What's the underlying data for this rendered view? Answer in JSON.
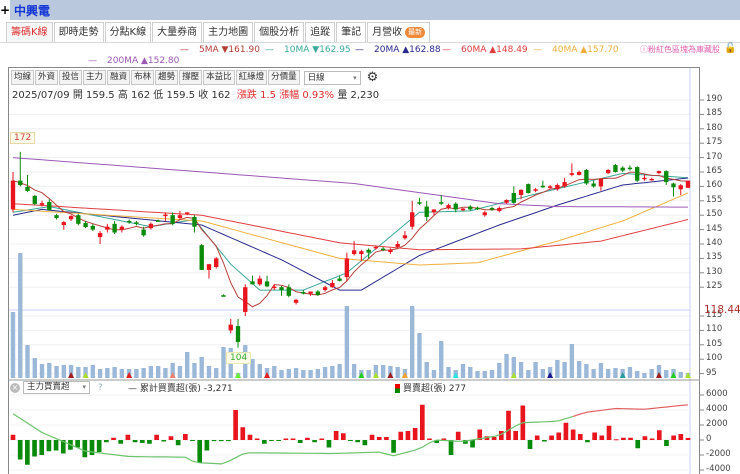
{
  "header": {
    "plus": "+",
    "stock_name": "中興電"
  },
  "tabs": [
    {
      "label": "籌碼K線",
      "active": true
    },
    {
      "label": "即時走勢"
    },
    {
      "label": "分點K線"
    },
    {
      "label": "大量券商"
    },
    {
      "label": "主力地圖"
    },
    {
      "label": "個股分析"
    },
    {
      "label": "追蹤"
    },
    {
      "label": "筆記"
    },
    {
      "label": "月營收",
      "badge": "最新"
    }
  ],
  "ma_legend": [
    {
      "label": "5MA ▼161.90",
      "color": "#b5403a"
    },
    {
      "label": "10MA ▼162.95",
      "color": "#3aa89a"
    },
    {
      "label": "20MA ▲162.88",
      "color": "#2b2b8c"
    },
    {
      "label": "60MA ▲148.49",
      "color": "#e04040"
    },
    {
      "label": "40MA ▲157.70",
      "color": "#f0b040"
    },
    {
      "label": "200MA ▲152.80",
      "color": "#9b59b6"
    }
  ],
  "note": "ⓘ粉紅色區塊為庫藏股",
  "toolbar": {
    "buttons": [
      "均線",
      "外資",
      "投信",
      "主力",
      "融資",
      "布林",
      "趨勢",
      "撐壓",
      "本益比",
      "紅綠燈",
      "分價量"
    ],
    "period": "日線"
  },
  "info": {
    "date": "2025/07/09",
    "open": "開 159.5",
    "high": "高 162",
    "low": "低 159.5",
    "close": "收 162",
    "change": "漲跌 1.5",
    "pct": "漲幅 0.93%",
    "volume": "量 2,230"
  },
  "indicator": {
    "select": "主力買賣超",
    "help": "?",
    "cum_label": "累計買賣超(張) -3,271",
    "net_label": "買賣超(張) 277"
  },
  "chart_data": [
    {
      "type": "candlestick",
      "title": "中興電 日線",
      "ylim": [
        95,
        190
      ],
      "yticks": [
        190,
        185,
        180,
        175,
        170,
        165,
        160,
        155,
        150,
        145,
        140,
        135,
        130,
        125,
        115,
        110,
        105,
        100,
        95
      ],
      "last_label": "118.44",
      "high_label": "172",
      "low_label": "104",
      "ohlc": [
        [
          152,
          165,
          151,
          162
        ],
        [
          162,
          172,
          160,
          160.5
        ],
        [
          159.8,
          164,
          158,
          158.4
        ],
        [
          156.7,
          157,
          153.5,
          153.9
        ],
        [
          153.6,
          155,
          153,
          154.2
        ],
        [
          154.6,
          155.5,
          151.5,
          151.8
        ],
        [
          150,
          150.5,
          148.5,
          149
        ],
        [
          146.6,
          148,
          145,
          147.6
        ],
        [
          148.6,
          150,
          148,
          149.7
        ],
        [
          150,
          150.5,
          146.5,
          147
        ],
        [
          147.3,
          148,
          145.5,
          145.9
        ],
        [
          146.3,
          147,
          144.5,
          145
        ],
        [
          142.4,
          144.5,
          140,
          143.8
        ],
        [
          145,
          147,
          144,
          146
        ],
        [
          147,
          148,
          143.5,
          144
        ],
        [
          145,
          146.5,
          144,
          146
        ],
        [
          148,
          148.5,
          147,
          147.5
        ],
        [
          147.5,
          148,
          146.5,
          147
        ],
        [
          145,
          146,
          142.5,
          143
        ],
        [
          145.5,
          147.5,
          145,
          147
        ],
        [
          148.2,
          148.5,
          147.8,
          148
        ],
        [
          149.8,
          151,
          148,
          150.2
        ],
        [
          150,
          151,
          146.5,
          147
        ],
        [
          149,
          151.5,
          148.5,
          150
        ],
        [
          150.6,
          151,
          150,
          151
        ],
        [
          149.4,
          150,
          144,
          146
        ],
        [
          139.6,
          140,
          131,
          131
        ],
        [
          131,
          133,
          128,
          133
        ],
        [
          132,
          135.5,
          131.5,
          135
        ],
        [
          122.2,
          122.5,
          121.8,
          122
        ],
        [
          110,
          114,
          109,
          112
        ],
        [
          111.5,
          114,
          104,
          106
        ],
        [
          116.4,
          126,
          115,
          125
        ],
        [
          127,
          129,
          126,
          126
        ],
        [
          126,
          129,
          125.5,
          128
        ],
        [
          127,
          129,
          125,
          125.3
        ],
        [
          124.8,
          126,
          124,
          125.2
        ],
        [
          125,
          125.5,
          122,
          124
        ],
        [
          125,
          126,
          121.5,
          122
        ],
        [
          119.6,
          121,
          119,
          120.6
        ],
        [
          123.3,
          124,
          122.5,
          123
        ],
        [
          122.8,
          123.5,
          122,
          123.5
        ],
        [
          123.5,
          124,
          122,
          122.3
        ],
        [
          124,
          125.5,
          123.5,
          125
        ],
        [
          125,
          127.5,
          124.8,
          126.5
        ],
        [
          128,
          129,
          127,
          127.2
        ],
        [
          128.5,
          137,
          127,
          135
        ],
        [
          136.5,
          141,
          136,
          137.8
        ],
        [
          136.5,
          138,
          134,
          137.5
        ],
        [
          138,
          138.5,
          135,
          137
        ],
        [
          138.5,
          139.5,
          138,
          139
        ],
        [
          138.4,
          139,
          137.5,
          138
        ],
        [
          137.2,
          138.5,
          136.5,
          138
        ],
        [
          139,
          141,
          138.5,
          140
        ],
        [
          142,
          144.5,
          141.5,
          143
        ],
        [
          146,
          155,
          145,
          151
        ],
        [
          154.5,
          156,
          153.5,
          154
        ],
        [
          153,
          155,
          148,
          149.4
        ],
        [
          151,
          152,
          150,
          152
        ],
        [
          154.5,
          157,
          153.5,
          154
        ],
        [
          152.5,
          154,
          152,
          153.5
        ],
        [
          154,
          154.5,
          151,
          152
        ],
        [
          151.7,
          152.5,
          151.5,
          152.3
        ],
        [
          153,
          153.5,
          151.5,
          152
        ],
        [
          152.6,
          153,
          151.8,
          152.2
        ],
        [
          150,
          151.5,
          149.5,
          151
        ],
        [
          152.5,
          153,
          151.5,
          152
        ],
        [
          151.5,
          153,
          151,
          152.5
        ],
        [
          154.3,
          155.5,
          154,
          155.3
        ],
        [
          157.7,
          160,
          154,
          154.3
        ],
        [
          157,
          159,
          155.5,
          158.8
        ],
        [
          160.8,
          161,
          157.5,
          157.7
        ],
        [
          158.5,
          159.5,
          158,
          159
        ],
        [
          160.2,
          162,
          159.5,
          159.8
        ],
        [
          159.5,
          160.5,
          159,
          160
        ],
        [
          159,
          161,
          158.5,
          160.5
        ],
        [
          160,
          163,
          159.5,
          161.5
        ],
        [
          164,
          168,
          163.5,
          164.6
        ],
        [
          164,
          165.5,
          163.8,
          165
        ],
        [
          165.7,
          166,
          160.5,
          161
        ],
        [
          161,
          162,
          159.5,
          160
        ],
        [
          160,
          162.8,
          158.5,
          162.6
        ],
        [
          164.6,
          166,
          164.3,
          165.7
        ],
        [
          167.4,
          167.8,
          164.8,
          165
        ],
        [
          166.5,
          167,
          165,
          165.5
        ],
        [
          166.5,
          167.3,
          165.5,
          166
        ],
        [
          166.7,
          167,
          161.5,
          162
        ],
        [
          162.5,
          164,
          162,
          163
        ],
        [
          162.4,
          163,
          162,
          162.6
        ],
        [
          164.6,
          165.5,
          164.2,
          165.3
        ],
        [
          165.3,
          165.6,
          160.5,
          161.5
        ],
        [
          161,
          161.3,
          156.5,
          159.7
        ],
        [
          159,
          160.8,
          157,
          160.4
        ],
        [
          159.5,
          162,
          159.5,
          162
        ]
      ],
      "ma_knots": {
        "10MA": [
          [
            0,
            151
          ],
          [
            5,
            153
          ],
          [
            19,
            146
          ],
          [
            25,
            148.5
          ],
          [
            30,
            133
          ],
          [
            34,
            124
          ],
          [
            40,
            124
          ],
          [
            46,
            130
          ],
          [
            56,
            151
          ],
          [
            63,
            151.5
          ],
          [
            73,
            158
          ],
          [
            84,
            164.5
          ],
          [
            93,
            163
          ]
        ],
        "20MA": [
          [
            0,
            150
          ],
          [
            4,
            152
          ],
          [
            26,
            146.6
          ],
          [
            37,
            134.5
          ],
          [
            45,
            124
          ],
          [
            48,
            124
          ],
          [
            56,
            136
          ],
          [
            67,
            146.6
          ],
          [
            75,
            153.5
          ],
          [
            84,
            160.5
          ],
          [
            93,
            162.9
          ]
        ],
        "40MA": [
          [
            0,
            152
          ],
          [
            26,
            148
          ],
          [
            45,
            135
          ],
          [
            56,
            132.7
          ],
          [
            64,
            133.5
          ],
          [
            75,
            141
          ],
          [
            84,
            148
          ],
          [
            93,
            157.7
          ]
        ],
        "60MA": [
          [
            0,
            154
          ],
          [
            26,
            150
          ],
          [
            45,
            140.4
          ],
          [
            56,
            138
          ],
          [
            70,
            138.3
          ],
          [
            81,
            141
          ],
          [
            93,
            148.5
          ]
        ],
        "200MA": [
          [
            0,
            170
          ],
          [
            47,
            161
          ],
          [
            67,
            154
          ],
          [
            75,
            153
          ],
          [
            93,
            152.8
          ]
        ]
      },
      "volume": [
        66,
        125,
        33,
        20,
        14,
        15,
        12,
        13,
        13,
        11,
        11,
        13,
        9,
        10,
        11,
        9,
        9,
        9,
        10,
        12,
        12,
        10,
        15,
        12,
        26,
        15,
        21,
        12,
        10,
        31,
        30,
        5,
        33,
        19,
        14,
        10,
        12,
        8,
        9,
        10,
        8,
        8,
        9,
        11,
        12,
        14,
        72,
        14,
        8,
        8,
        13,
        13,
        12,
        11,
        9,
        72,
        45,
        16,
        8,
        37,
        11,
        8,
        14,
        11,
        7,
        7,
        8,
        15,
        24,
        21,
        16,
        8,
        16,
        9,
        11,
        18,
        16,
        34,
        17,
        14,
        9,
        15,
        9,
        10,
        9,
        11,
        7,
        5,
        9,
        13,
        8,
        9,
        6,
        5
      ],
      "signals": [
        [
          8,
          "#a02020"
        ],
        [
          10,
          "#aadd33"
        ],
        [
          16,
          "#e02020"
        ],
        [
          22,
          "#f08070"
        ],
        [
          31,
          "#66ee33"
        ],
        [
          35,
          "#e02020"
        ],
        [
          48,
          "#22cc22"
        ],
        [
          50,
          "#aadd33"
        ],
        [
          52,
          "#a02020"
        ],
        [
          54,
          "#f0a030"
        ],
        [
          61,
          "#33e0e0"
        ],
        [
          69,
          "#aadd33"
        ],
        [
          74,
          "#1a1a90"
        ],
        [
          84,
          "#2a9a9a"
        ],
        [
          89,
          "#a02020"
        ],
        [
          91,
          "#22cc22"
        ],
        [
          93,
          "#aadd33"
        ]
      ]
    },
    {
      "type": "bar",
      "title": "主力買賣超",
      "ylim": [
        -4000,
        6000
      ],
      "yticks": [
        6000,
        4000,
        2000,
        0,
        -2000,
        -4000
      ],
      "net": [
        700,
        -2600,
        -3300,
        -2200,
        -2000,
        -1500,
        -1400,
        -1800,
        -1300,
        -1000,
        -2300,
        -2000,
        -1600,
        -300,
        300,
        -500,
        700,
        -300,
        -400,
        -500,
        700,
        -200,
        500,
        -700,
        800,
        -100,
        -3000,
        -1400,
        -150,
        -150,
        -150,
        4000,
        1700,
        700,
        200,
        -500,
        -100,
        -100,
        200,
        200,
        -400,
        300,
        -300,
        200,
        -1000,
        1200,
        900,
        -100,
        -300,
        -700,
        700,
        400,
        400,
        -1700,
        1100,
        1200,
        1600,
        4700,
        200,
        -400,
        200,
        -2000,
        1100,
        -500,
        -1000,
        1400,
        500,
        400,
        1200,
        3900,
        1200,
        4600,
        -1200,
        600,
        -200,
        600,
        1000,
        2300,
        1400,
        800,
        -300,
        1000,
        600,
        1900,
        100,
        300,
        300,
        -1100,
        500,
        200,
        1300,
        -800,
        600,
        800,
        277
      ],
      "cumulative_knots": [
        [
          0,
          3500
        ],
        [
          4,
          1000
        ],
        [
          10,
          -1500
        ],
        [
          16,
          -2200
        ],
        [
          24,
          -2300
        ],
        [
          25,
          -3000
        ],
        [
          29,
          -3200
        ],
        [
          32,
          -1700
        ],
        [
          44,
          -1800
        ],
        [
          51,
          -1600
        ],
        [
          52,
          -2200
        ],
        [
          56,
          -1200
        ],
        [
          58,
          0
        ],
        [
          62,
          -200
        ],
        [
          67,
          600
        ],
        [
          70,
          2300
        ],
        [
          75,
          2500
        ],
        [
          79,
          3700
        ],
        [
          83,
          4200
        ],
        [
          87,
          4100
        ],
        [
          93,
          4700
        ]
      ]
    }
  ]
}
